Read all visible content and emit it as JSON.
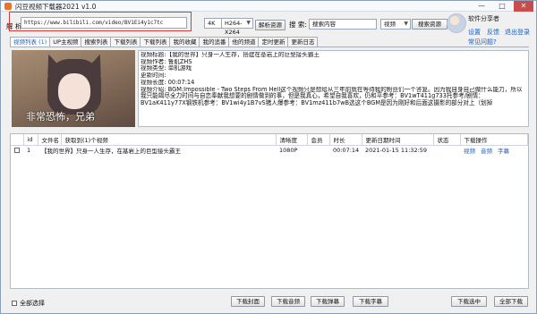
{
  "window": {
    "title": "闪豆视频下载器2021 v1.0",
    "min": "—",
    "max": "□",
    "close": "✕"
  },
  "parse": {
    "label": "解 析",
    "url": "https://www.bilibili.com/video/BV1Ei4y1c7tc",
    "resolution": "4K",
    "codec": "H264-X264",
    "button": "解析资源"
  },
  "search": {
    "label": "搜 索:",
    "value": "搜索内容",
    "type": "视频",
    "button": "搜索资源"
  },
  "user": {
    "name": "软件分享者",
    "settings": "设置",
    "feedback": "反馈",
    "logout": "退出登录",
    "faq": "常见问题?"
  },
  "tabs": [
    "视频列表 (1)",
    "UP主视频",
    "搜索列表",
    "下载列表",
    "下载列表",
    "我的收藏",
    "我的追番",
    "他的频道",
    "定时更新",
    "更新日志"
  ],
  "preview": {
    "caption": "非常恐怖，兄弟",
    "lines": [
      "视频标题:【我的世界】只身一人生存，搭建在基岩上的巨型接头霸王",
      "视频作者: 鲁肌ZHS",
      "视频类型: 单机游戏",
      "更新时间:",
      "视频长度: 00:07:14"
    ],
    "intro": "视频介绍: BGM:Impossible - Two Steps From Hell这个视频只是想给从三年前就在等待我的粉丝们一个答复。因为我自身自己做什么能力，所以我只能竭尽全力时间与自恋奉献我想要的剧情做到的事，但是我真心，希望自我喜欢，仍和平参考：BV1wT411g733托参考/剧情：BV1aK411y77X钢铁机参考：BV1wi4y1B7vS猪人爆参考：BV1mz411b7wB选这个BGM是因为刚好和后面这摄影的部分对上（划掉"
  },
  "table": {
    "headers": [
      "",
      "id",
      "文件名",
      "获取到(1)个视频",
      "清晰度",
      "会员",
      "时长",
      "更新日期时间",
      "状态",
      "下载操作"
    ],
    "rows": [
      {
        "id": "1",
        "name": "【我的世界】只身一人生存，在基岩上的巨型接头霸王",
        "quality": "1080P",
        "vip": "",
        "duration": "00:07:14",
        "updated": "2021-01-15 11:32:59",
        "status": "",
        "actions": [
          "视频",
          "音频",
          "字幕"
        ]
      }
    ]
  },
  "bottom": {
    "select_all": "全部选择",
    "download_cover": "下载封面",
    "download_audio": "下载音频",
    "download_danmu": "下载弹幕",
    "download_subtitle": "下载字幕",
    "download_selected": "下载选中",
    "download_all": "全部下载"
  }
}
